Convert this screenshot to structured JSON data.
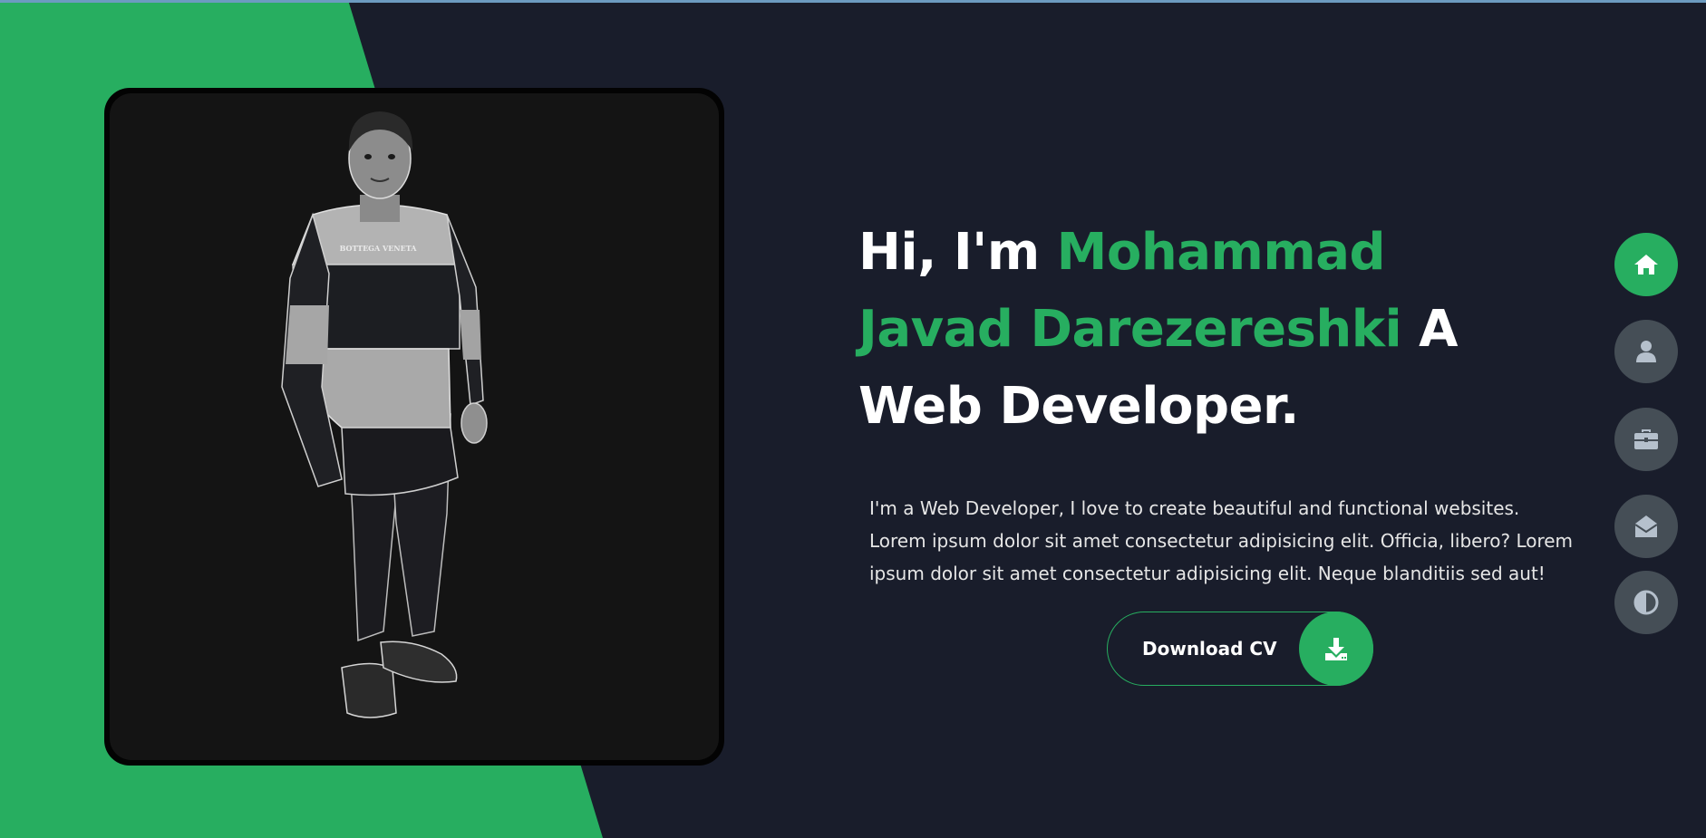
{
  "hero": {
    "title_prefix": "Hi, I'm ",
    "title_name": "Mohammad Javad Darezereshki",
    "title_suffix": " A Web Developer.",
    "description": "I'm a Web Developer, I love to create beautiful and functional websites. Lorem ipsum dolor sit amet consectetur adipisicing elit. Officia, libero? Lorem ipsum dolor sit amet consectetur adipisicing elit. Neque blanditiis sed aut!",
    "shirt_text": "BOTTEGA VENETA"
  },
  "cv_button": {
    "label": "Download CV",
    "icon": "download-icon"
  },
  "nav": {
    "items": [
      {
        "id": "home",
        "icon": "home-icon",
        "active": true
      },
      {
        "id": "about",
        "icon": "user-icon",
        "active": false
      },
      {
        "id": "portfolio",
        "icon": "briefcase-icon",
        "active": false
      },
      {
        "id": "contact",
        "icon": "envelope-open-icon",
        "active": false
      },
      {
        "id": "theme",
        "icon": "contrast-icon",
        "active": false
      }
    ]
  },
  "colors": {
    "accent": "#27ae60",
    "background": "#191d2b",
    "nav_inactive": "#454e56",
    "icon_inactive": "#b5c0cc",
    "text": "#ffffff"
  }
}
